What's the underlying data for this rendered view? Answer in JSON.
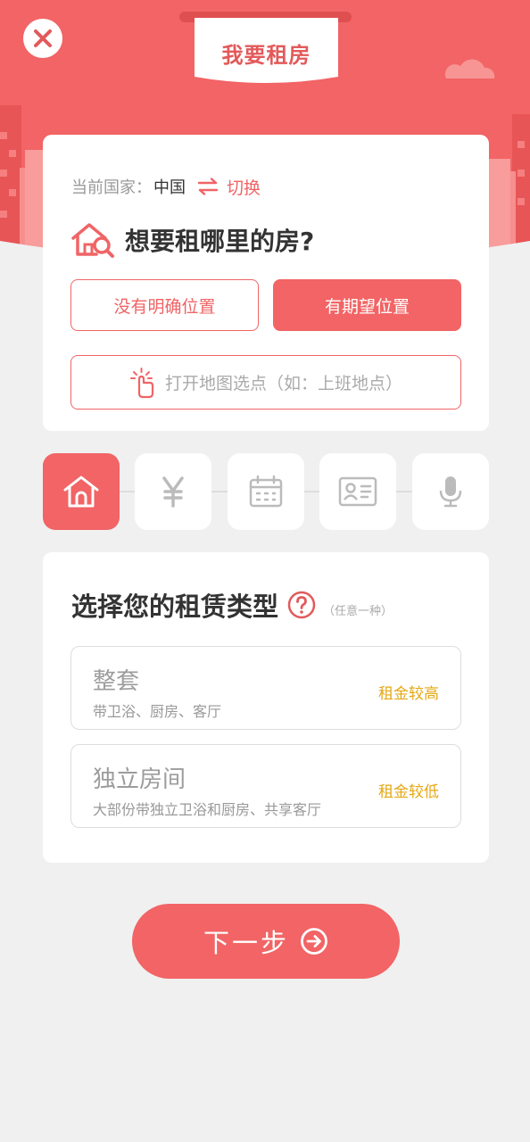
{
  "header": {
    "title": "我要租房",
    "close_icon": "close-icon"
  },
  "location": {
    "country_label": "当前国家：",
    "country_value": "中国",
    "switch_label": "切换",
    "question": "想要租哪里的房?",
    "options": [
      "没有明确位置",
      "有期望位置"
    ],
    "selected_option": "有期望位置",
    "map_placeholder": "打开地图选点（如：上班地点）"
  },
  "steps": [
    {
      "icon": "house-icon",
      "active": true
    },
    {
      "icon": "yen-icon",
      "active": false
    },
    {
      "icon": "calendar-icon",
      "active": false
    },
    {
      "icon": "id-card-icon",
      "active": false
    },
    {
      "icon": "microphone-icon",
      "active": false
    }
  ],
  "rental_type": {
    "title": "选择您的租赁类型",
    "hint": "（任意一种）",
    "options": [
      {
        "name": "整套",
        "desc": "带卫浴、厨房、客厅",
        "tag": "租金较高"
      },
      {
        "name": "独立房间",
        "desc": "大部份带独立卫浴和厨房、共享客厅",
        "tag": "租金较低"
      }
    ]
  },
  "footer": {
    "next_label": "下一步"
  },
  "colors": {
    "primary": "#f26465",
    "tag": "#e4a814",
    "page_bg": "#f0f0f0"
  }
}
